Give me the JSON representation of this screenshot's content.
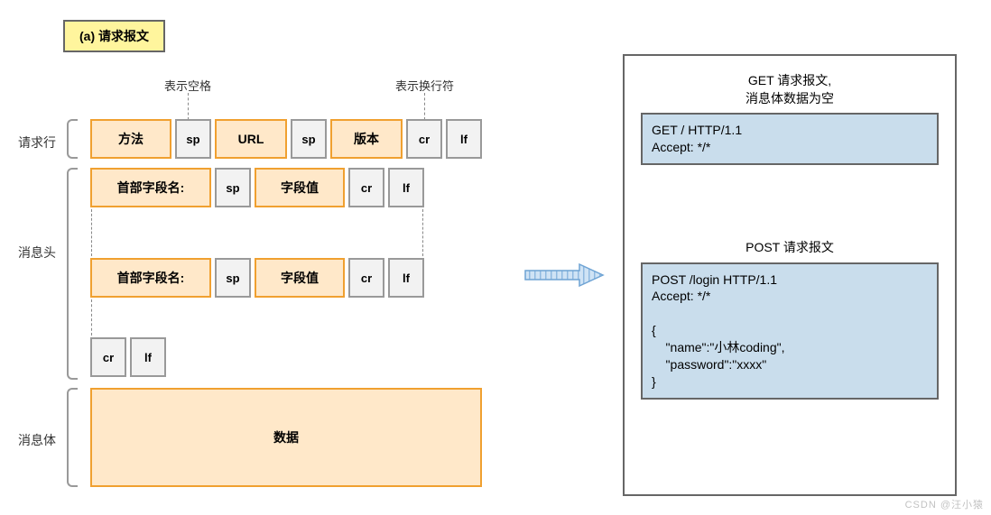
{
  "title": "(a)  请求报文",
  "tips": {
    "space": "表示空格",
    "newline": "表示换行符"
  },
  "sections": {
    "requestLine": "请求行",
    "header": "消息头",
    "body": "消息体"
  },
  "row1": {
    "method": "方法",
    "sp1": "sp",
    "url": "URL",
    "sp2": "sp",
    "version": "版本",
    "cr": "cr",
    "lf": "lf"
  },
  "row2": {
    "name": "首部字段名:",
    "sp": "sp",
    "value": "字段值",
    "cr": "cr",
    "lf": "lf"
  },
  "row3": {
    "name": "首部字段名:",
    "sp": "sp",
    "value": "字段值",
    "cr": "cr",
    "lf": "lf"
  },
  "row4": {
    "cr": "cr",
    "lf": "lf"
  },
  "bodyCell": "数据",
  "right": {
    "getTitle": "GET 请求报文,\n消息体数据为空",
    "getCode": "GET / HTTP/1.1\nAccept: */*",
    "postTitle": "POST 请求报文",
    "postCode": "POST /login HTTP/1.1\nAccept: */*\n\n{\n    \"name\":\"小林coding\",\n    \"password\":\"xxxx\"\n}"
  },
  "watermark": "CSDN @汪小猿"
}
